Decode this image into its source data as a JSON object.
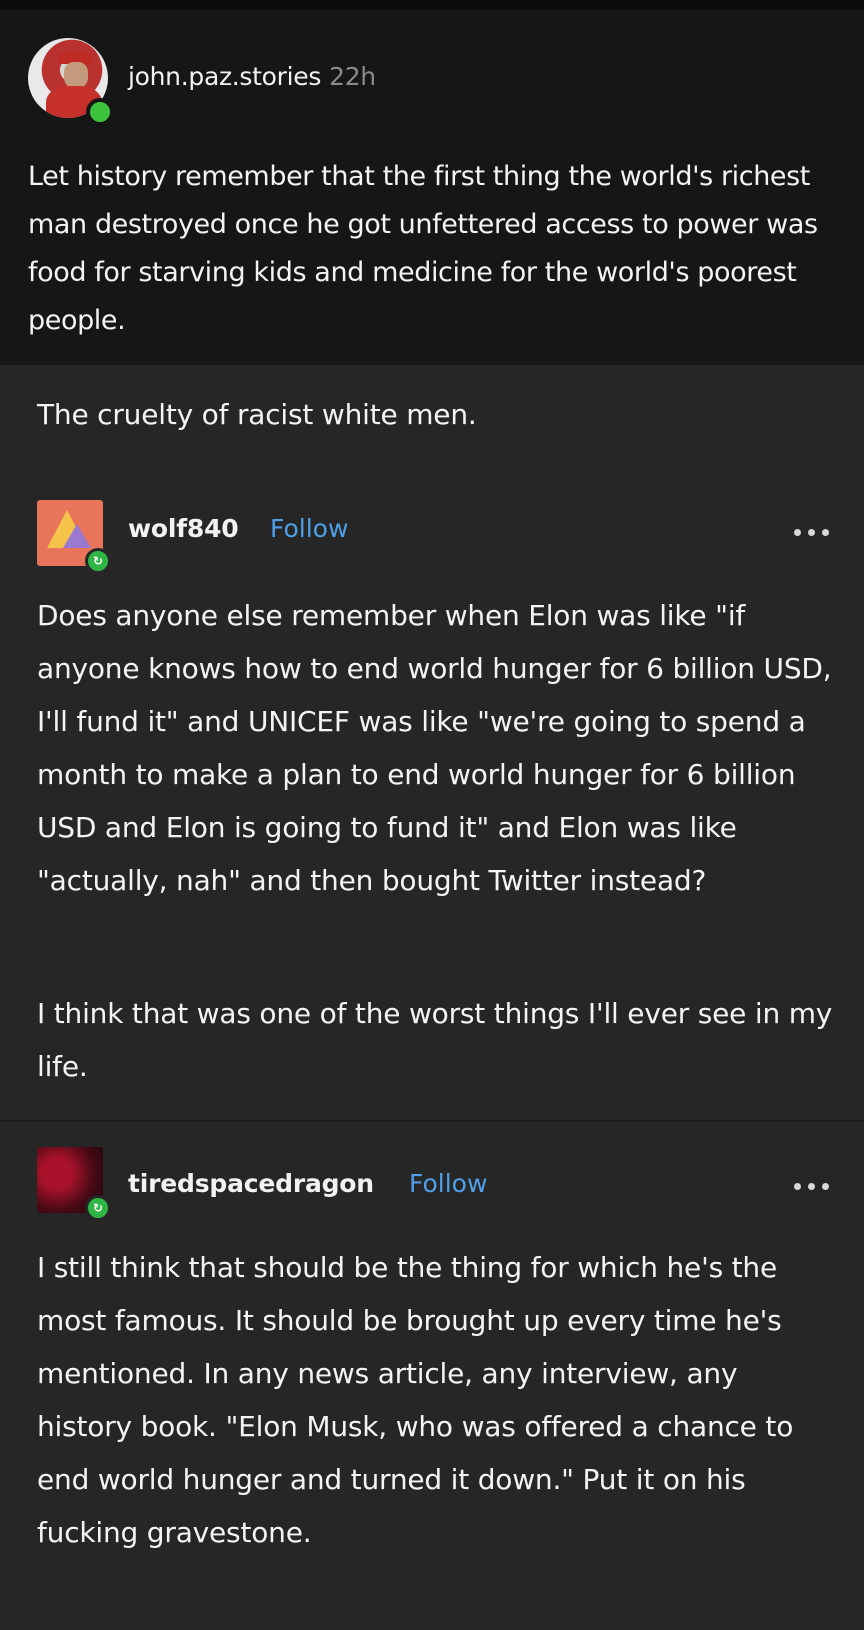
{
  "top_post": {
    "username": "john.paz.stories",
    "time": "22h",
    "text": "Let history remember that the first thing the world's richest man destroyed once he got unfettered access to power was food for starving kids and medicine for the world's poorest people."
  },
  "op_post": {
    "text": "The cruelty of racist white men."
  },
  "reblogs": [
    {
      "username": "wolf840",
      "follow_label": "Follow",
      "paragraphs": [
        "Does anyone else remember when Elon was like \"if anyone knows how to end world hunger for 6 billion USD, I'll fund it\" and UNICEF was like \"we're going to spend a month to make a plan to end world hunger for 6 billion USD and Elon is going to fund it\" and Elon was like \"actually, nah\" and then bought Twitter instead?",
        "I think that was one of the worst things I'll ever see in my life."
      ]
    },
    {
      "username": "tiredspacedragon",
      "follow_label": "Follow",
      "paragraphs": [
        "I still think that should be the thing for which he's the most famous. It should be brought up every time he's mentioned. In any news article, any interview, any history book. \"Elon Musk, who was offered a chance to end world hunger and turned it down.\" Put it on his fucking gravestone."
      ]
    }
  ],
  "icons": {
    "more": "more-options-icon",
    "reblog_badge": "reblog-icon",
    "online": "online-status-icon"
  },
  "colors": {
    "top_background": "#161616",
    "post_background": "#262626",
    "follow_link": "#4f9fe8",
    "online_dot": "#3ec33e",
    "reblog_badge": "#2fb546"
  }
}
